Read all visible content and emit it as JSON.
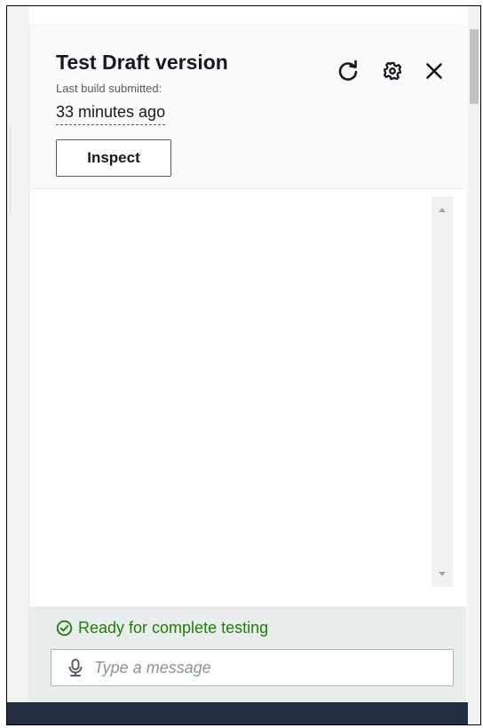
{
  "panel": {
    "title": "Test Draft version",
    "subtitle": "Last build submitted:",
    "time_ago": "33 minutes ago",
    "inspect_label": "Inspect",
    "icons": {
      "refresh": "refresh-icon",
      "settings": "gear-icon",
      "close": "close-icon"
    }
  },
  "footer": {
    "status_text": "Ready for complete testing",
    "status_icon": "check-circle-icon",
    "message_placeholder": "Type a message",
    "message_value": "",
    "mic_icon": "microphone-icon"
  },
  "colors": {
    "status_green": "#1d8102",
    "bottom_bar": "#232f3e",
    "footer_bg": "#eaeded"
  }
}
